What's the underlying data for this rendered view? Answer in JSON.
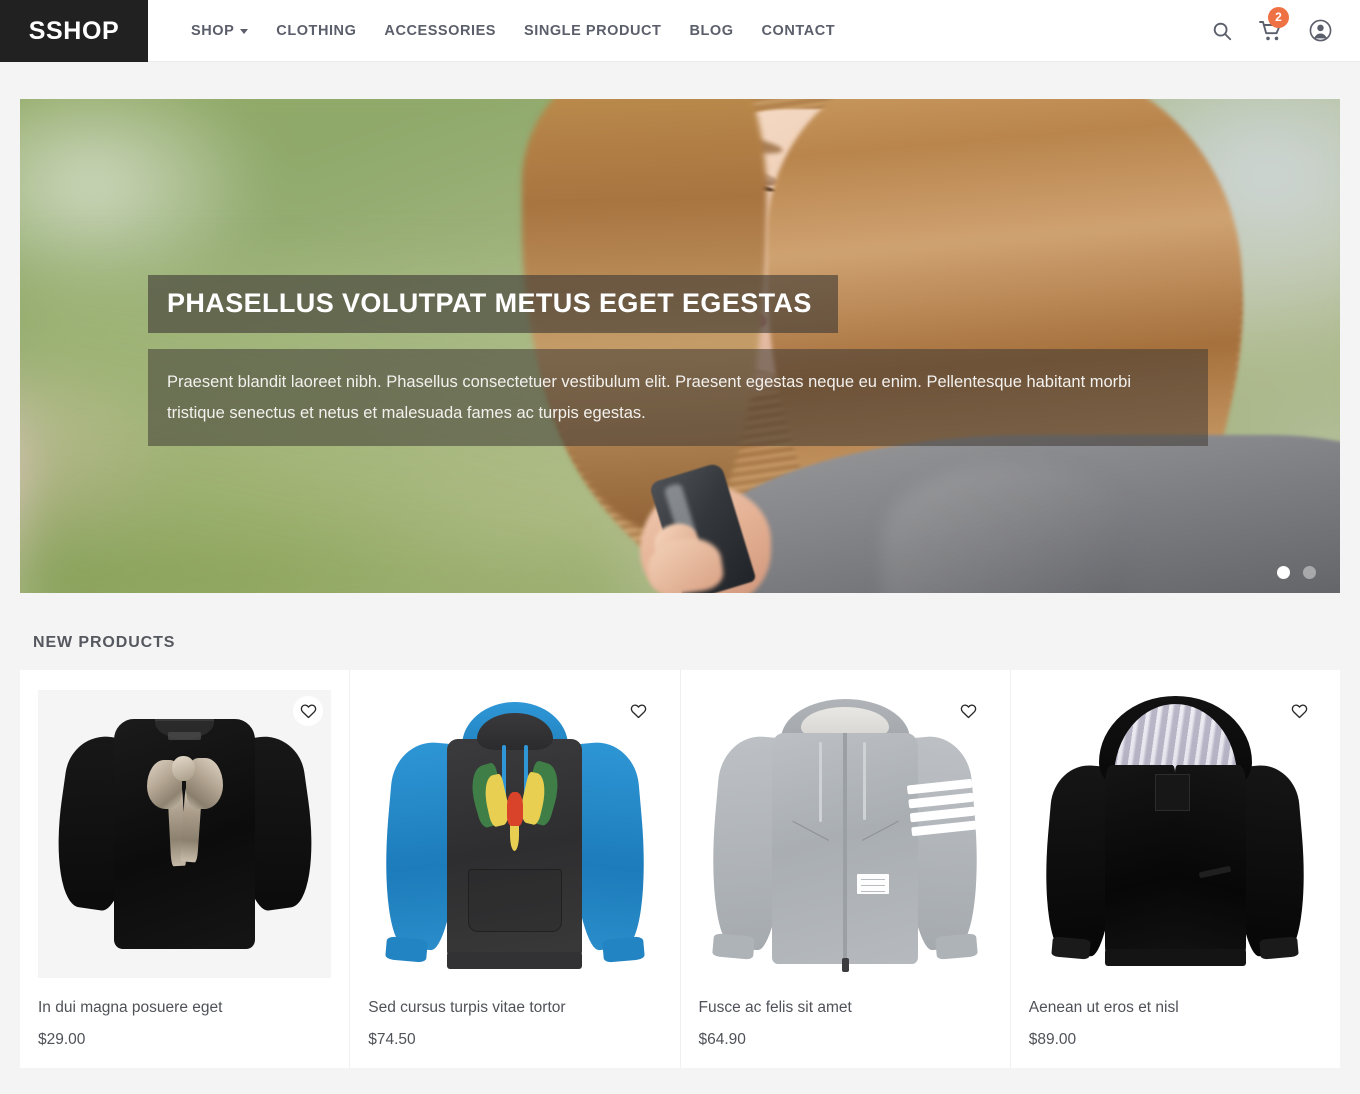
{
  "header": {
    "logo": "SSHOP",
    "nav": [
      {
        "label": "SHOP",
        "has_dropdown": true
      },
      {
        "label": "CLOTHING",
        "has_dropdown": false
      },
      {
        "label": "ACCESSORIES",
        "has_dropdown": false
      },
      {
        "label": "SINGLE PRODUCT",
        "has_dropdown": false
      },
      {
        "label": "BLOG",
        "has_dropdown": false
      },
      {
        "label": "CONTACT",
        "has_dropdown": false
      }
    ],
    "actions": {
      "search_icon": "search-icon",
      "cart_icon": "shopping-cart-icon",
      "cart_count": "2",
      "account_icon": "user-account-icon"
    },
    "accent_color": "#ef7245",
    "logo_bg": "#212121"
  },
  "hero": {
    "title": "PHASELLUS VOLUTPAT METUS EGET EGESTAS",
    "subtitle": "Praesent blandit laoreet nibh. Phasellus consectetuer vestibulum elit. Praesent egestas neque eu enim. Pellentesque habitant morbi tristique senectus et netus et malesuada fames ac turpis egestas.",
    "slides": [
      {
        "active": true
      },
      {
        "active": false
      }
    ]
  },
  "new_products": {
    "heading": "NEW PRODUCTS",
    "wishlist_icon": "heart-icon",
    "items": [
      {
        "name": "In dui magna posuere eget",
        "price": "$29.00",
        "image": "black-long-sleeve-tee-with-silver-sequin-bow"
      },
      {
        "name": "Sed cursus turpis vitae tortor",
        "price": "$74.50",
        "image": "blue-sleeve-raglan-hoodie-with-parrot-graphic"
      },
      {
        "name": "Fusce ac felis sit amet",
        "price": "$64.90",
        "image": "gray-zip-hoodie-with-four-white-sleeve-stripes"
      },
      {
        "name": "Aenean ut eros et nisl",
        "price": "$89.00",
        "image": "black-sherpa-lined-zip-hoodie"
      }
    ]
  }
}
